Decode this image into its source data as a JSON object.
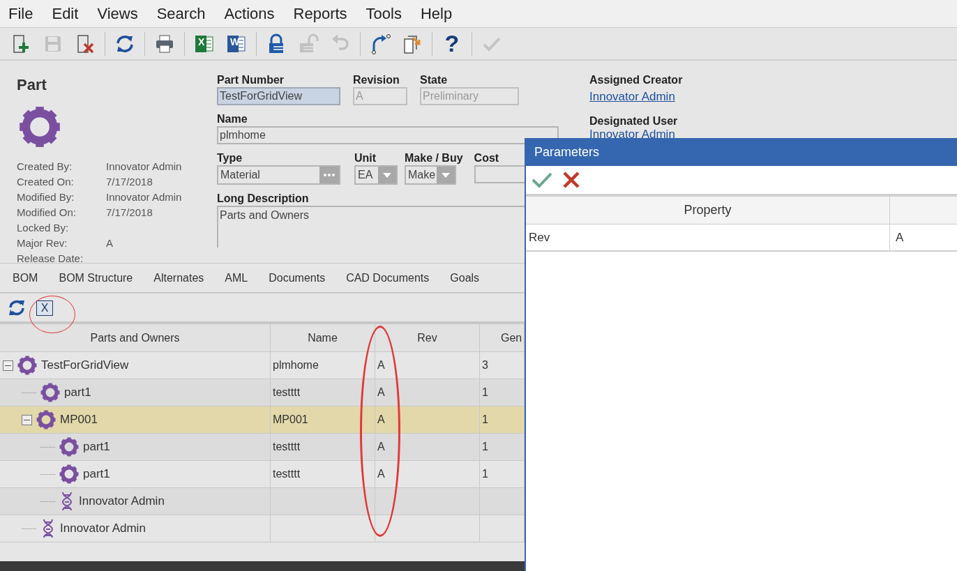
{
  "menu": [
    "File",
    "Edit",
    "Views",
    "Search",
    "Actions",
    "Reports",
    "Tools",
    "Help"
  ],
  "toolbar": [
    {
      "kind": "new",
      "disabled": false
    },
    {
      "kind": "save",
      "disabled": true
    },
    {
      "kind": "delete",
      "disabled": false
    },
    {
      "kind": "sep"
    },
    {
      "kind": "refresh",
      "disabled": false
    },
    {
      "kind": "sep"
    },
    {
      "kind": "print",
      "disabled": false
    },
    {
      "kind": "sep"
    },
    {
      "kind": "excel",
      "disabled": false,
      "glyph": "X"
    },
    {
      "kind": "word",
      "disabled": false,
      "glyph": "W"
    },
    {
      "kind": "sep"
    },
    {
      "kind": "lock",
      "disabled": false
    },
    {
      "kind": "unlock",
      "disabled": true
    },
    {
      "kind": "undo",
      "disabled": true
    },
    {
      "kind": "sep"
    },
    {
      "kind": "route",
      "disabled": false
    },
    {
      "kind": "copy",
      "disabled": false
    },
    {
      "kind": "sep"
    },
    {
      "kind": "help",
      "disabled": false,
      "glyph": "?"
    },
    {
      "kind": "sep"
    },
    {
      "kind": "done",
      "disabled": true
    }
  ],
  "item": {
    "type": "Part",
    "meta": [
      {
        "label": "Created By:",
        "value": "Innovator Admin"
      },
      {
        "label": "Created On:",
        "value": "7/17/2018"
      },
      {
        "label": "Modified By:",
        "value": "Innovator Admin"
      },
      {
        "label": "Modified On:",
        "value": "7/17/2018"
      },
      {
        "label": "Locked By:"
      },
      {
        "label": "Major Rev:",
        "value": "A"
      },
      {
        "label": "Release Date:"
      }
    ]
  },
  "form": {
    "part_number": {
      "label": "Part Number",
      "value": "TestForGridView",
      "focused": true
    },
    "revision": {
      "label": "Revision",
      "value": "A",
      "disabled": true
    },
    "state": {
      "label": "State",
      "value": "Preliminary",
      "disabled": true
    },
    "name": {
      "label": "Name",
      "value": "plmhome"
    },
    "type": {
      "label": "Type",
      "value": "Material"
    },
    "unit": {
      "label": "Unit",
      "value": "EA"
    },
    "make_buy": {
      "label": "Make / Buy",
      "value": "Make"
    },
    "cost": {
      "label": "Cost"
    },
    "long_description": {
      "label": "Long Description",
      "value": "Parts and Owners"
    },
    "assigned_creator": {
      "label": "Assigned Creator",
      "value": "Innovator Admin"
    },
    "designated_user": {
      "label": "Designated User",
      "value": "Innovator Admin"
    }
  },
  "tabs": [
    {
      "label": "BOM",
      "selected": false
    },
    {
      "label": "BOM Structure",
      "selected": false
    },
    {
      "label": "Alternates",
      "selected": false
    },
    {
      "label": "AML",
      "selected": false
    },
    {
      "label": "Documents",
      "selected": false
    },
    {
      "label": "CAD Documents",
      "selected": false
    },
    {
      "label": "Goals",
      "selected": false
    }
  ],
  "grid_toolbar": {
    "export_glyph": "X"
  },
  "grid": {
    "columns": [
      "Parts and Owners",
      "Name",
      "Rev",
      "Gen"
    ],
    "rows": [
      {
        "kind": "part",
        "label": "TestForGridView",
        "name": "plmhome",
        "rev": "A",
        "column_4": "3",
        "expanded": true,
        "selected": false,
        "children": [
          {
            "kind": "part",
            "label": "part1",
            "name": "testttt",
            "rev": "A",
            "column_4": "1",
            "selected": false
          },
          {
            "kind": "part",
            "label": "MP001",
            "name": "MP001",
            "rev": "A",
            "column_4": "1",
            "expanded": true,
            "selected": true,
            "children": [
              {
                "kind": "part",
                "label": "part1",
                "name": "testttt",
                "rev": "A",
                "column_4": "1",
                "selected": false
              },
              {
                "kind": "part",
                "label": "part1",
                "name": "testttt",
                "rev": "A",
                "column_4": "1",
                "selected": false
              },
              {
                "kind": "identity",
                "label": "Innovator Admin",
                "selected": false
              }
            ]
          },
          {
            "kind": "identity",
            "label": "Innovator Admin",
            "selected": false
          }
        ]
      }
    ]
  },
  "parameters": {
    "title": "Parameters",
    "columns": [
      "Property"
    ],
    "rows": [
      {
        "property": "Rev",
        "value": "A"
      }
    ]
  }
}
